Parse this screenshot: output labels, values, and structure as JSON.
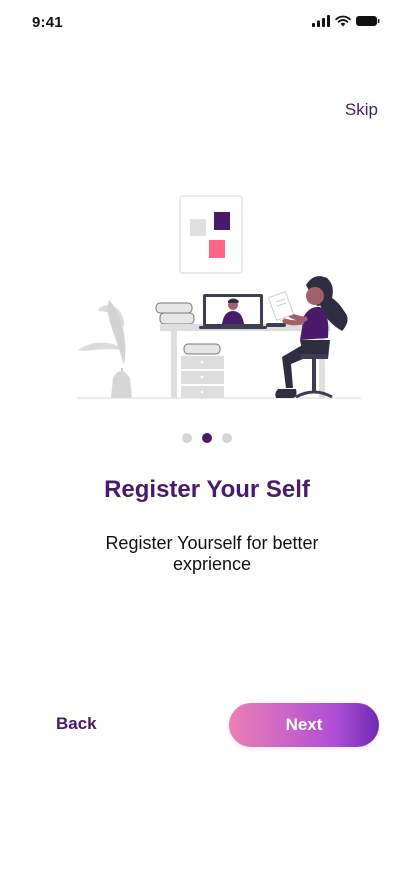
{
  "status_bar": {
    "time": "9:41",
    "icons": [
      "cellular-signal-icon",
      "wifi-icon",
      "battery-icon"
    ]
  },
  "header": {
    "skip_label": "Skip"
  },
  "onboarding": {
    "title": "Register Your Self",
    "subtitle": "Register Yourself for better exprience",
    "page_count": 3,
    "active_page": 2
  },
  "footer": {
    "back_label": "Back",
    "next_label": "Next"
  },
  "colors": {
    "accent": "#4a1a6b",
    "button_gradient_start": "#ec7fb4",
    "button_gradient_end": "#6f2bb3",
    "inactive_dot": "#d6d6d6"
  }
}
